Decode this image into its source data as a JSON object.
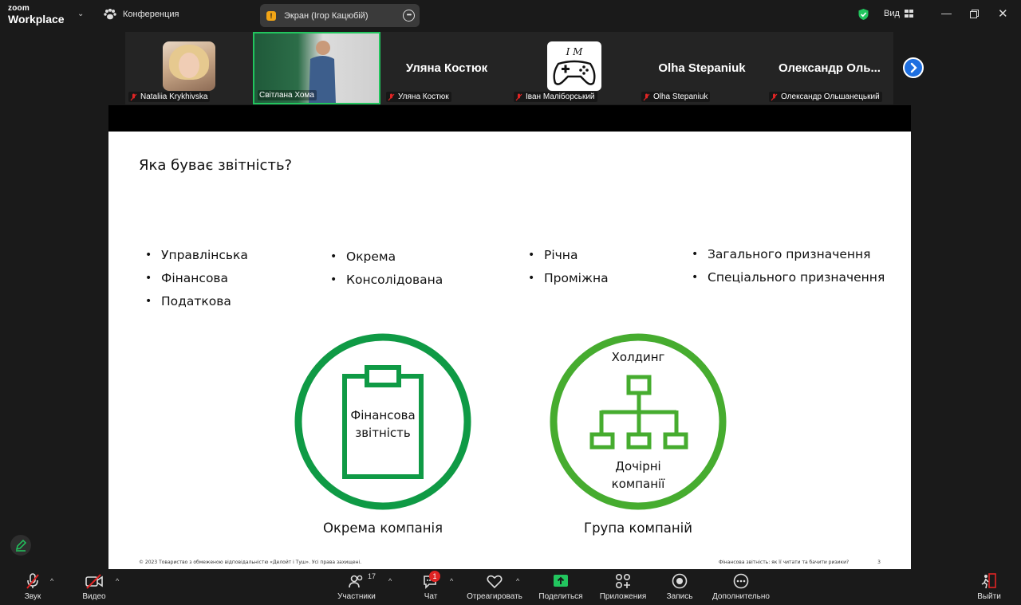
{
  "app": {
    "logo_small": "zoom",
    "logo_big": "Workplace",
    "conference_label": "Конференция",
    "screen_share_label": "Экран (Ігор Кацюбій)",
    "view_label": "Вид"
  },
  "participants": [
    {
      "name": "Nataliia Krykhivska",
      "display": "photo"
    },
    {
      "name": "Світлана Хома",
      "display": "video"
    },
    {
      "name": "Уляна Костюк",
      "display": "name",
      "big_name": "Уляна Костюк"
    },
    {
      "name": "Іван Маліборський",
      "display": "logo"
    },
    {
      "name": "Olha Stepaniuk",
      "display": "name",
      "big_name": "Olha Stepaniuk"
    },
    {
      "name": "Олександр Ольшанецький",
      "display": "name",
      "big_name": "Олександр Оль..."
    }
  ],
  "slide": {
    "title": "Яка буває звітність?",
    "col1": [
      "Управлінська",
      "Фінансова",
      "Податкова"
    ],
    "col2": [
      "Окрема",
      "Консолідована"
    ],
    "col3": [
      "Річна",
      "Проміжна"
    ],
    "col4": [
      "Загального призначення",
      "Спеціального призначення"
    ],
    "circle1_inner_line1": "Фінансова",
    "circle1_inner_line2": "звітність",
    "circle1_label": "Окрема компанія",
    "circle2_top": "Холдинг",
    "circle2_bottom_line1": "Дочірні",
    "circle2_bottom_line2": "компанії",
    "circle2_label": "Група компаній",
    "footer_left": "© 2023 Товариство з обмеженою відповідальністю «Делойт і Туш». Усі права захищені.",
    "footer_right": "Фінансова звітність: як її читати та бачити ризики?",
    "page_number": "3",
    "colors": {
      "circle1": "#0f9a45",
      "circle2": "#46ac2f"
    }
  },
  "toolbar": {
    "audio": "Звук",
    "video": "Видео",
    "participants": "Участники",
    "participants_count": "17",
    "chat": "Чат",
    "chat_badge": "1",
    "react": "Отреагировать",
    "share": "Поделиться",
    "apps": "Приложения",
    "record": "Запись",
    "more": "Дополнительно",
    "leave": "Выйти"
  }
}
